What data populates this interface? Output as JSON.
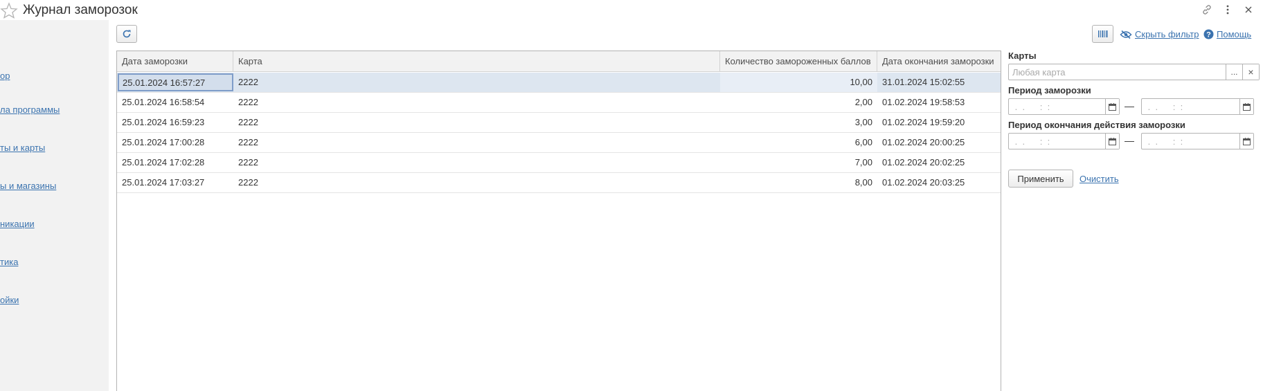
{
  "header": {
    "title": "Журнал заморозок"
  },
  "sidebar": {
    "items": [
      {
        "label": "ор"
      },
      {
        "label": "ла программы"
      },
      {
        "label": "ты и карты"
      },
      {
        "label": "ы и магазины"
      },
      {
        "label": "никации"
      },
      {
        "label": "тика"
      },
      {
        "label": "ойки"
      }
    ]
  },
  "toolbar": {
    "hide_filter_label": "Скрыть фильтр",
    "help_label": "Помощь"
  },
  "table": {
    "columns": [
      "Дата заморозки",
      "Карта",
      "Количество замороженных баллов",
      "Дата окончания заморозки"
    ],
    "rows": [
      {
        "date": "25.01.2024 16:57:27",
        "card": "2222",
        "points": "10,00",
        "end": "31.01.2024 15:02:55"
      },
      {
        "date": "25.01.2024 16:58:54",
        "card": "2222",
        "points": "2,00",
        "end": "01.02.2024 19:58:53"
      },
      {
        "date": "25.01.2024 16:59:23",
        "card": "2222",
        "points": "3,00",
        "end": "01.02.2024 19:59:20"
      },
      {
        "date": "25.01.2024 17:00:28",
        "card": "2222",
        "points": "6,00",
        "end": "01.02.2024 20:00:25"
      },
      {
        "date": "25.01.2024 17:02:28",
        "card": "2222",
        "points": "7,00",
        "end": "01.02.2024 20:02:25"
      },
      {
        "date": "25.01.2024 17:03:27",
        "card": "2222",
        "points": "8,00",
        "end": "01.02.2024 20:03:25"
      }
    ]
  },
  "filter": {
    "cards_label": "Карты",
    "cards_placeholder": "Любая карта",
    "cards_select_btn": "...",
    "cards_clear_btn": "×",
    "freeze_period_label": "Период заморозки",
    "end_period_label": "Период окончания действия заморозки",
    "date_mask": " .  .      :  :",
    "range_dash": "—",
    "apply_label": "Применить",
    "clear_label": "Очистить"
  },
  "colors": {
    "link": "#3b73af",
    "selected_row": "#dde6f0",
    "header_bg": "#f2f2f2"
  }
}
